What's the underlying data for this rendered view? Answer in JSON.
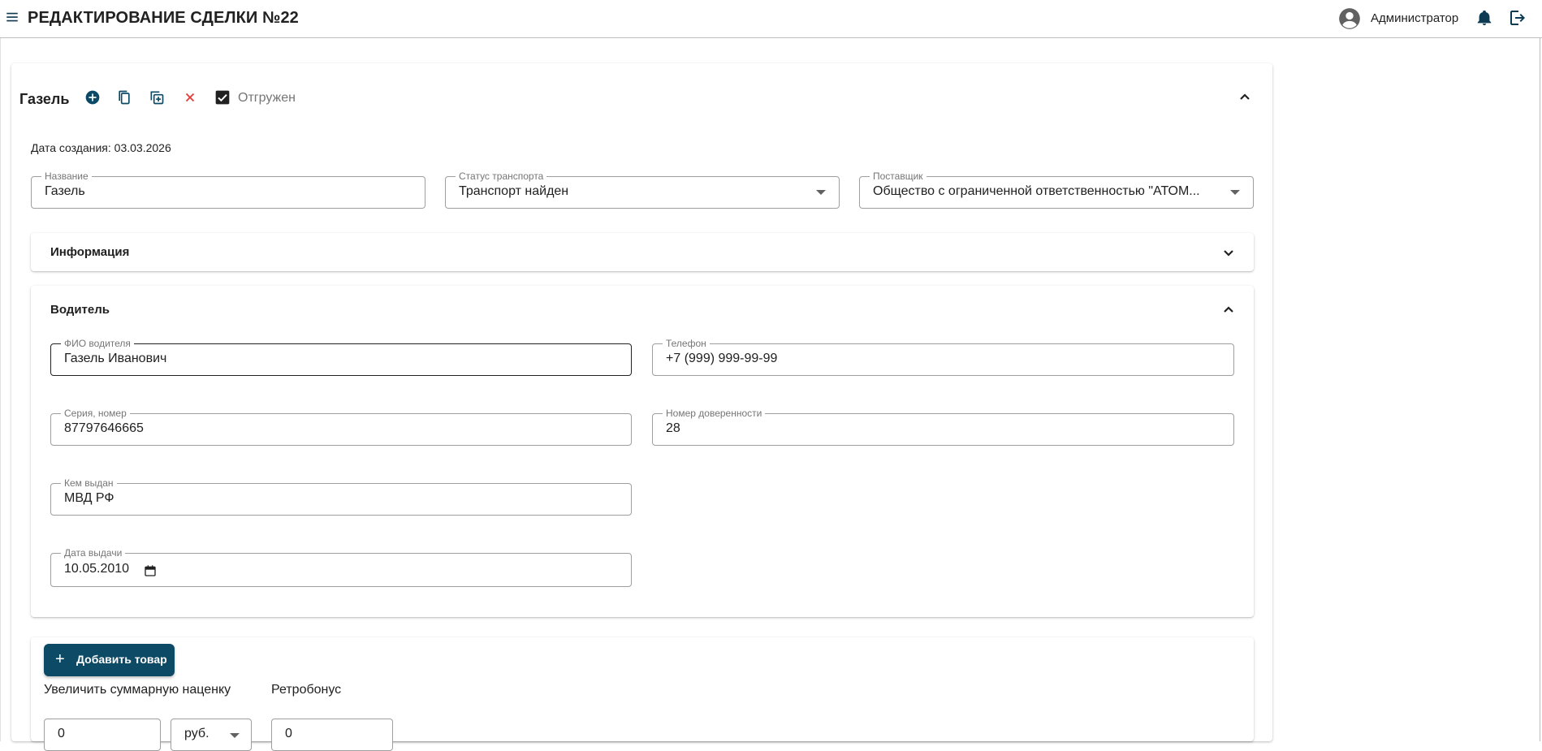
{
  "header": {
    "title": "РЕДАКТИРОВАНИЕ СДЕЛКИ №22",
    "user_name": "Администратор"
  },
  "vehicle": {
    "title": "Газель",
    "shipped_label": "Отгружен",
    "shipped_checked": true,
    "created_text": "Дата создания: 03.03.2026",
    "fields": {
      "name": {
        "label": "Название",
        "value": "Газель"
      },
      "transport_status": {
        "label": "Статус транспорта",
        "value": "Транспорт найден"
      },
      "supplier": {
        "label": "Поставщик",
        "value": "Общество с ограниченной ответственностью \"АТОМ..."
      }
    }
  },
  "info_section": {
    "title": "Информация",
    "expanded": false
  },
  "driver_section": {
    "title": "Водитель",
    "expanded": true,
    "fields": {
      "full_name": {
        "label": "ФИО водителя",
        "value": "Газель Иванович"
      },
      "phone": {
        "label": "Телефон",
        "value": "+7 (999) 999-99-99"
      },
      "passport": {
        "label": "Серия, номер",
        "value": "87797646665"
      },
      "power_of_attorney": {
        "label": "Номер доверенности",
        "value": "28"
      },
      "issued_by": {
        "label": "Кем выдан",
        "value": "МВД РФ"
      },
      "issue_date": {
        "label": "Дата выдачи",
        "value": "10.05.2010"
      }
    }
  },
  "goods": {
    "add_button": "Добавить товар",
    "markup_label": "Увеличить суммарную наценку",
    "markup_value": "0",
    "currency_value": "руб.",
    "retrobonus_label": "Ретробонус",
    "retrobonus_value": "0"
  },
  "colors": {
    "primary": "#0d4a66",
    "danger": "#e53935",
    "border": "#9e9e9e"
  },
  "icons": [
    "menu-icon",
    "account-circle-icon",
    "bell-icon",
    "logout-icon",
    "add-circle-icon",
    "copy-icon",
    "duplicate-icon",
    "close-icon",
    "checkbox-checked-icon",
    "chevron-up-icon",
    "chevron-down-icon",
    "calendar-icon",
    "plus-icon"
  ]
}
